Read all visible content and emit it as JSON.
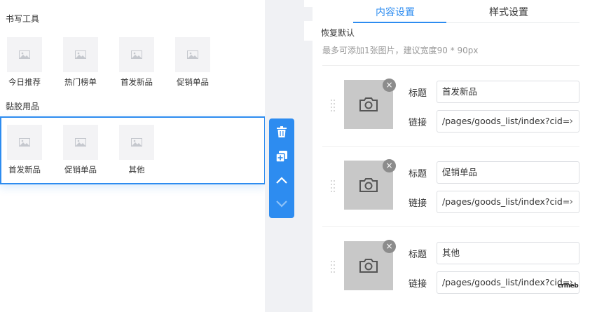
{
  "canvas": {
    "header_partial": "书写工具",
    "groups": [
      {
        "title": "书写工具",
        "items": [
          "今日推荐",
          "热门榜单",
          "首发新品",
          "促销单品"
        ]
      },
      {
        "title": "黏胶用品",
        "items": [
          "首发新品",
          "促销单品",
          "其他"
        ]
      }
    ]
  },
  "toolbar": {
    "delete": "trash-icon",
    "copy": "copy-icon",
    "up": "chevron-up-icon",
    "down": "chevron-down-icon"
  },
  "panel": {
    "tabs": [
      "内容设置",
      "样式设置"
    ],
    "active_tab": "内容设置",
    "restore_label": "恢复默认",
    "hint": "最多可添加1张图片，建议宽度90 * 90px",
    "title_label": "标题",
    "link_label": "链接",
    "items": [
      {
        "title": "首发新品",
        "link": "/pages/goods_list/index?cid="
      },
      {
        "title": "促销单品",
        "link": "/pages/goods_list/index?cid="
      },
      {
        "title": "其他",
        "link": "/pages/goods_list/index?cid="
      }
    ]
  },
  "brand": "crmeb",
  "colors": {
    "accent": "#2d8cf0",
    "placeholder": "#c8c8c8"
  }
}
